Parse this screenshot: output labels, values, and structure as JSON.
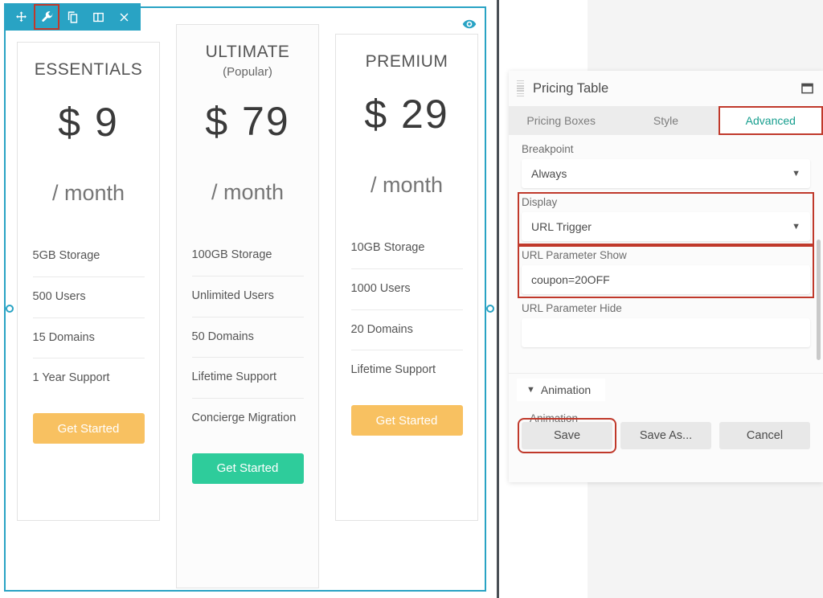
{
  "editor": {
    "toolbar": [
      {
        "name": "move-icon",
        "label": "Move"
      },
      {
        "name": "wrench-icon",
        "label": "Settings",
        "highlighted": true
      },
      {
        "name": "duplicate-icon",
        "label": "Duplicate"
      },
      {
        "name": "columns-icon",
        "label": "Columns"
      },
      {
        "name": "close-icon",
        "label": "Delete"
      }
    ],
    "preview_icon": "eye-icon",
    "accent_color": "#29a3c4",
    "highlight_color": "#c0392b"
  },
  "pricing": {
    "cards": [
      {
        "title": "ESSENTIALS",
        "subtitle": "",
        "currency": "$",
        "price": "9",
        "period": "/ month",
        "features": [
          "5GB Storage",
          "500 Users",
          "15 Domains",
          "1 Year Support"
        ],
        "cta": "Get Started",
        "cta_color": "#f8c161"
      },
      {
        "title": "ULTIMATE",
        "subtitle": "(Popular)",
        "currency": "$",
        "price": "79",
        "period": "/ month",
        "features": [
          "100GB Storage",
          "Unlimited Users",
          "50 Domains",
          "Lifetime Support",
          "Concierge Migration"
        ],
        "cta": "Get Started",
        "cta_color": "#2ecc9b"
      },
      {
        "title": "PREMIUM",
        "subtitle": "",
        "currency": "$",
        "price": "29",
        "period": "/ month",
        "features": [
          "10GB Storage",
          "1000 Users",
          "20 Domains",
          "Lifetime Support"
        ],
        "cta": "Get Started",
        "cta_color": "#f8c161"
      }
    ]
  },
  "dialog": {
    "title": "Pricing Table",
    "maximize_icon": "window-maximize-icon",
    "grip_icon": "drag-handle-icon",
    "tabs": [
      {
        "label": "Pricing Boxes",
        "active": false
      },
      {
        "label": "Style",
        "active": false
      },
      {
        "label": "Advanced",
        "active": true,
        "highlighted": true
      }
    ],
    "fields": {
      "breakpoint": {
        "label": "Breakpoint",
        "value": "Always"
      },
      "display": {
        "label": "Display",
        "value": "URL Trigger",
        "highlighted": true
      },
      "url_param_show": {
        "label": "URL Parameter Show",
        "value": "coupon=20OFF",
        "highlighted": true
      },
      "url_param_hide": {
        "label": "URL Parameter Hide",
        "value": ""
      }
    },
    "accordion": {
      "title": "Animation",
      "inner_label": "Animation"
    },
    "buttons": [
      {
        "label": "Save",
        "highlighted": true
      },
      {
        "label": "Save As...",
        "highlighted": false
      },
      {
        "label": "Cancel",
        "highlighted": false
      }
    ]
  }
}
